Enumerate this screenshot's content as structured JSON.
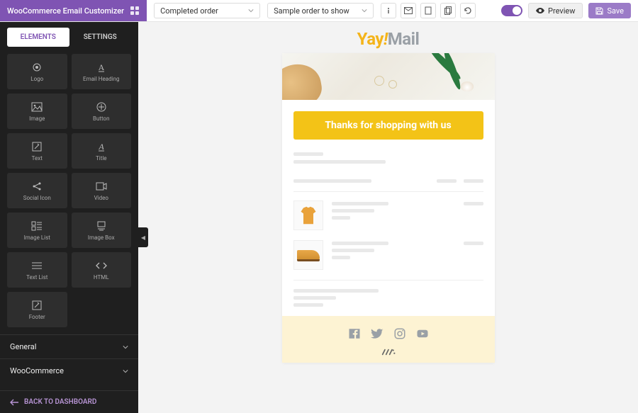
{
  "brand": {
    "title": "WooCommerce Email Customizer"
  },
  "top": {
    "email_type": "Completed order",
    "sample_order": "Sample order to show",
    "preview_label": "Preview",
    "save_label": "Save"
  },
  "sidebar": {
    "tabs": {
      "elements": "ELEMENTS",
      "settings": "SETTINGS"
    },
    "elements": [
      {
        "label": "Logo",
        "icon": "logo-icon"
      },
      {
        "label": "Email Heading",
        "icon": "heading-icon"
      },
      {
        "label": "Image",
        "icon": "image-icon"
      },
      {
        "label": "Button",
        "icon": "button-icon"
      },
      {
        "label": "Text",
        "icon": "text-icon"
      },
      {
        "label": "Title",
        "icon": "title-icon"
      },
      {
        "label": "Social Icon",
        "icon": "share-icon"
      },
      {
        "label": "Video",
        "icon": "video-icon"
      },
      {
        "label": "Image List",
        "icon": "image-list-icon"
      },
      {
        "label": "Image Box",
        "icon": "image-box-icon"
      },
      {
        "label": "Text List",
        "icon": "text-list-icon"
      },
      {
        "label": "HTML",
        "icon": "html-icon"
      },
      {
        "label": "Footer",
        "icon": "footer-icon"
      }
    ],
    "accordion": {
      "general": "General",
      "woocommerce": "WooCommerce"
    },
    "back_label": "BACK TO DASHBOARD"
  },
  "preview": {
    "logo": {
      "part1": "Yay",
      "part2": "!",
      "part3": "Mail"
    },
    "headline": "Thanks for shopping with us"
  },
  "colors": {
    "brand": "#7f54b3",
    "accent": "#f3c317",
    "sidebar_bg": "#1f1f1f"
  }
}
